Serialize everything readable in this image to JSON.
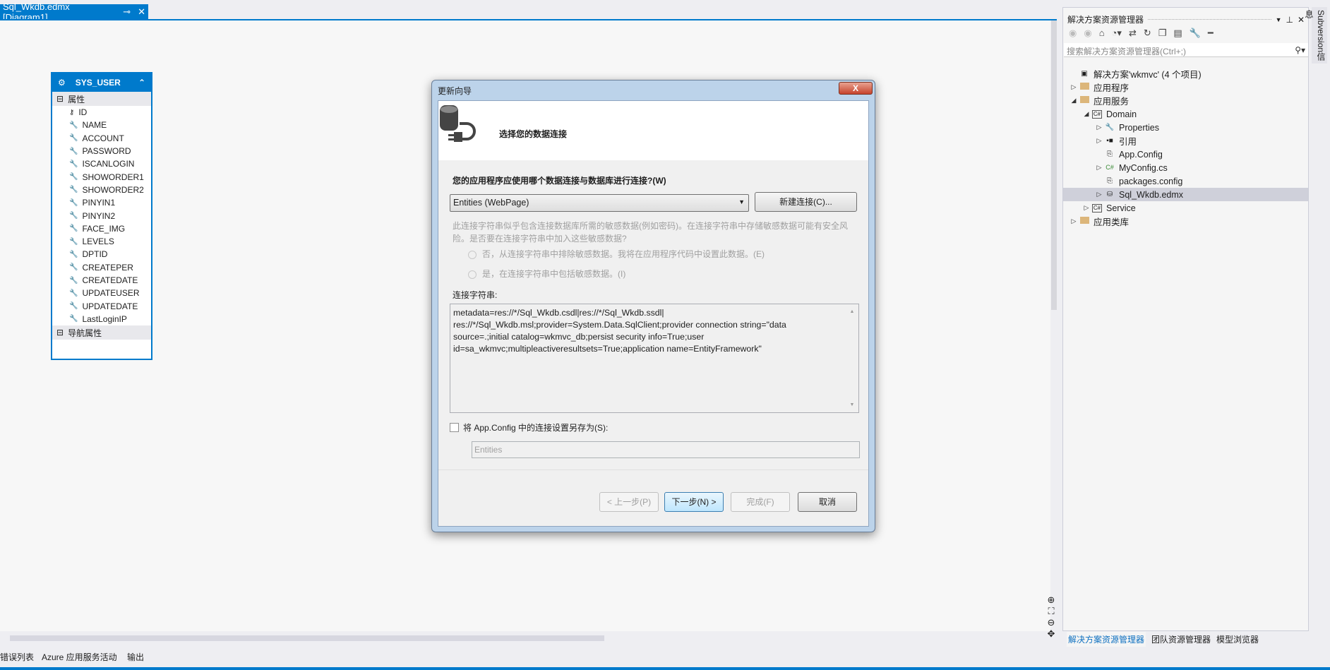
{
  "document_tab": {
    "title": "Sql_Wkdb.edmx [Diagram1]",
    "pin_icon": "pin-icon",
    "close_icon": "close-icon"
  },
  "entity": {
    "name": "SYS_USER",
    "properties_header": "属性",
    "nav_header": "导航属性",
    "properties": [
      "ID",
      "NAME",
      "ACCOUNT",
      "PASSWORD",
      "ISCANLOGIN",
      "SHOWORDER1",
      "SHOWORDER2",
      "PINYIN1",
      "PINYIN2",
      "FACE_IMG",
      "LEVELS",
      "DPTID",
      "CREATEPER",
      "CREATEDATE",
      "UPDATEUSER",
      "UPDATEDATE",
      "LastLoginIP"
    ]
  },
  "dialog": {
    "title": "更新向导",
    "close": "X",
    "heading": "选择您的数据连接",
    "question": "您的应用程序应使用哪个数据连接与数据库进行连接?(W)",
    "connection_selected": "Entities (WebPage)",
    "new_connection": "新建连接(C)...",
    "warning_line1": "此连接字符串似乎包含连接数据库所需的敏感数据(例如密码)。在连接字符串中存储敏感数据可能有安全风",
    "warning_line2": "险。是否要在连接字符串中加入这些敏感数据?",
    "radio_no": "否，从连接字符串中排除敏感数据。我将在应用程序代码中设置此数据。(E)",
    "radio_yes": "是，在连接字符串中包括敏感数据。(I)",
    "conn_string_label": "连接字符串:",
    "conn_string_lines": [
      "metadata=res://*/Sql_Wkdb.csdl|res://*/Sql_Wkdb.ssdl|",
      "res://*/Sql_Wkdb.msl;provider=System.Data.SqlClient;provider connection string=\"data",
      "source=.;initial catalog=wkmvc_db;persist security info=True;user",
      "id=sa_wkmvc;multipleactiveresultsets=True;application name=EntityFramework\""
    ],
    "save_checkbox": "将 App.Config 中的连接设置另存为(S):",
    "save_checked": false,
    "save_name": "Entities",
    "buttons": {
      "prev": "< 上一步(P)",
      "next": "下一步(N) >",
      "finish": "完成(F)",
      "cancel": "取消"
    }
  },
  "solution_explorer": {
    "title": "解决方案资源管理器",
    "search_placeholder": "搜索解决方案资源管理器(Ctrl+;)",
    "tree": [
      {
        "label": "解决方案'wkmvc' (4 个项目)",
        "level": 0,
        "twisty": "",
        "icon": "solution"
      },
      {
        "label": "应用程序",
        "level": 0,
        "twisty": "collapsed",
        "icon": "folder"
      },
      {
        "label": "应用服务",
        "level": 0,
        "twisty": "expanded",
        "icon": "folder"
      },
      {
        "label": "Domain",
        "level": 1,
        "twisty": "expanded",
        "icon": "csproj"
      },
      {
        "label": "Properties",
        "level": 2,
        "twisty": "collapsed",
        "icon": "wrench"
      },
      {
        "label": "引用",
        "level": 2,
        "twisty": "collapsed",
        "icon": "references"
      },
      {
        "label": "App.Config",
        "level": 2,
        "twisty": "",
        "icon": "config"
      },
      {
        "label": "MyConfig.cs",
        "level": 2,
        "twisty": "collapsed",
        "icon": "csfile"
      },
      {
        "label": "packages.config",
        "level": 2,
        "twisty": "",
        "icon": "config"
      },
      {
        "label": "Sql_Wkdb.edmx",
        "level": 2,
        "twisty": "collapsed",
        "icon": "edmx",
        "selected": true
      },
      {
        "label": "Service",
        "level": 1,
        "twisty": "collapsed",
        "icon": "csproj"
      },
      {
        "label": "应用类库",
        "level": 0,
        "twisty": "collapsed",
        "icon": "folder"
      }
    ],
    "bottom_tabs": [
      "解决方案资源管理器",
      "团队资源管理器",
      "模型浏览器"
    ]
  },
  "side_tab": "Subversion信息",
  "bottom_tabs": [
    "错误列表",
    "Azure 应用服务活动",
    "输出"
  ],
  "colors": {
    "accent": "#007acc"
  }
}
